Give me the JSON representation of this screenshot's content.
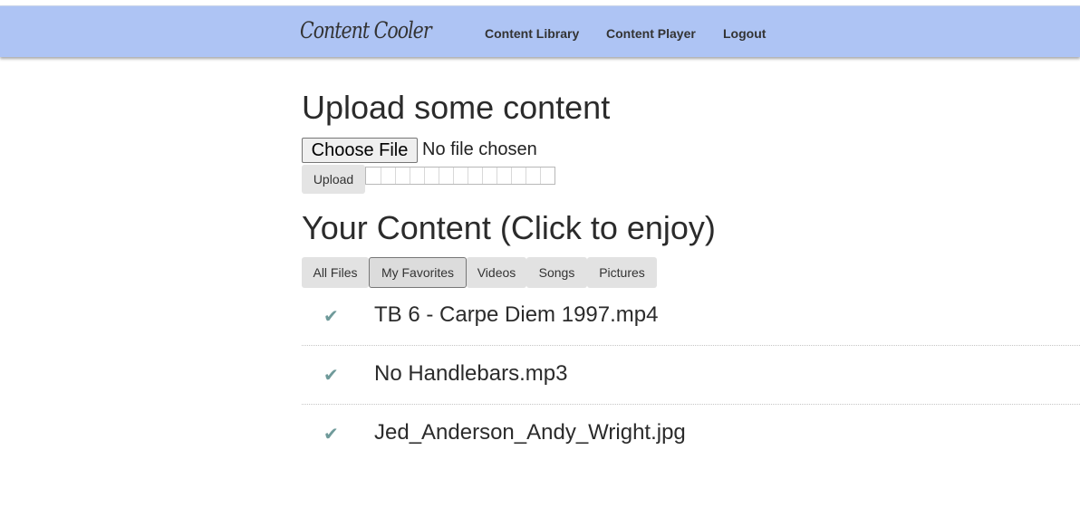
{
  "header": {
    "brand": "Content Cooler",
    "nav": [
      {
        "label": "Content Library"
      },
      {
        "label": "Content Player"
      },
      {
        "label": "Logout"
      }
    ],
    "bar_color": "#aec4f4"
  },
  "upload": {
    "heading": "Upload some content",
    "choose_file_label": "Choose File",
    "file_status": "No file chosen",
    "upload_label": "Upload",
    "progress": 0,
    "progress_segments": 13
  },
  "content": {
    "heading": "Your Content (Click to enjoy)",
    "tabs": [
      {
        "label": "All Files"
      },
      {
        "label": "My Favorites",
        "active": true
      },
      {
        "label": "Videos"
      },
      {
        "label": "Songs"
      },
      {
        "label": "Pictures"
      }
    ],
    "items": [
      {
        "check_icon": "checkmark-icon",
        "name": "TB 6 - Carpe Diem 1997.mp4"
      },
      {
        "check_icon": "checkmark-icon",
        "name": "No Handlebars.mp3"
      },
      {
        "check_icon": "checkmark-icon",
        "name": "Jed_Anderson_Andy_Wright.jpg"
      }
    ],
    "check_color": "#6f9a9a"
  }
}
